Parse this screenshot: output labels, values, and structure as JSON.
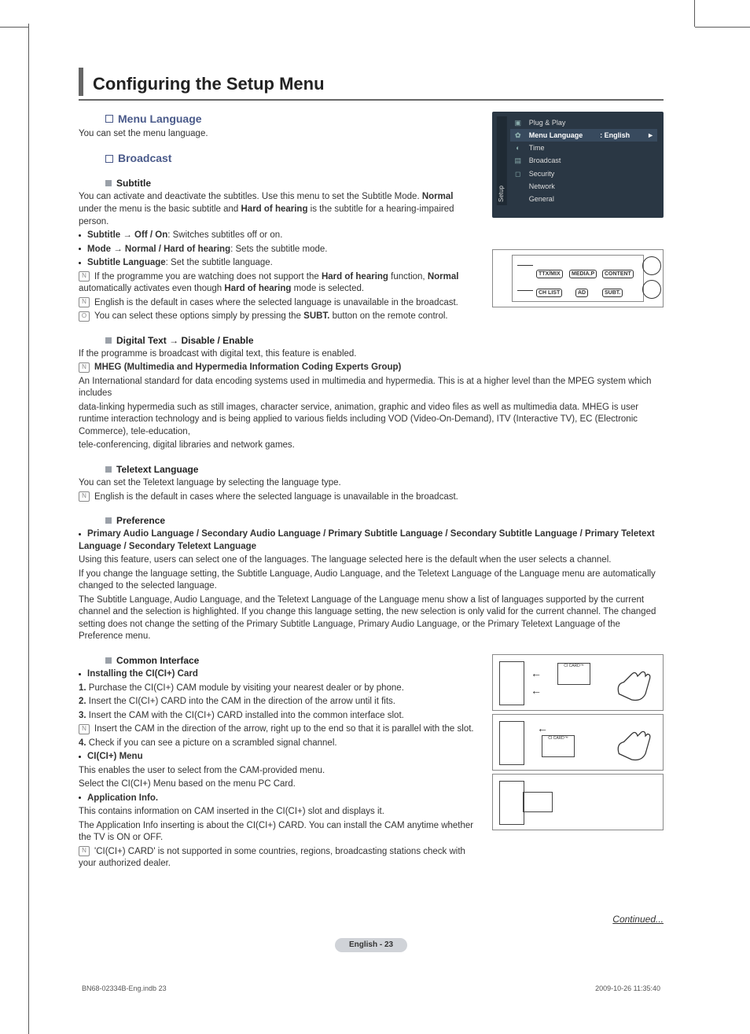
{
  "title": "Configuring the Setup Menu",
  "menuLanguage": {
    "heading": "Menu Language",
    "desc": "You can set the menu language."
  },
  "broadcast": {
    "heading": "Broadcast"
  },
  "subtitle": {
    "heading": "Subtitle",
    "p1a": "You can activate and deactivate the subtitles. Use this menu to set the Subtitle Mode. ",
    "p1b_bold": "Normal",
    "p1c": " under the menu is the basic subtitle and ",
    "p1d_bold": "Hard of hearing",
    "p1e": " is the subtitle for a hearing-impaired person.",
    "b1_bold": "Subtitle → Off / On",
    "b1_rest": ": Switches subtitles off or on.",
    "b2_bold": "Mode → Normal / Hard of hearing",
    "b2_rest": ": Sets the subtitle mode.",
    "b3_bold": "Subtitle Language",
    "b3_rest": ": Set the subtitle language.",
    "n1a": "If the programme you are watching does not support the ",
    "n1b_bold": "Hard of hearing",
    "n1c": " function, ",
    "n1d_bold": "Normal",
    "n1e": " automatically activates even though ",
    "n1f_bold": "Hard of hearing",
    "n1g": " mode is selected.",
    "n2": "English is the default in cases where the selected language is unavailable in the broadcast.",
    "n3a": "You can select these options simply by pressing the ",
    "n3b_bold": "SUBT.",
    "n3c": " button on the remote control."
  },
  "osd": {
    "sideLabel": "Setup",
    "items": [
      "Plug & Play",
      "Menu Language",
      "Time",
      "Broadcast",
      "Security",
      "Network",
      "General"
    ],
    "selectedValue": ": English",
    "arrow": "►"
  },
  "remote": {
    "btns": [
      "TTX/MIX",
      "MEDIA.P",
      "CONTENT",
      "CH LIST",
      "AD",
      "SUBT."
    ]
  },
  "digitalText": {
    "heading": "Digital Text → Disable / Enable",
    "desc": "If the programme is broadcast with digital text, this feature is enabled.",
    "mheg_bold": "MHEG (Multimedia and Hypermedia Information Coding Experts Group)",
    "mheg_p1": "An International standard for data encoding systems used in multimedia and hypermedia. This is at a higher level than the MPEG system which includes",
    "mheg_p2": "data-linking hypermedia such as still images, character service, animation, graphic and video files as well as multimedia data. MHEG is user runtime interaction technology and is being applied to various fields including VOD (Video-On-Demand), ITV (Interactive TV), EC (Electronic Commerce), tele-education,",
    "mheg_p3": "tele-conferencing, digital libraries and network games."
  },
  "teletext": {
    "heading": "Teletext Language",
    "desc": "You can set the Teletext language by selecting the language type.",
    "note": "English is the default in cases where the selected language is unavailable in the broadcast."
  },
  "preference": {
    "heading": "Preference",
    "bold": "Primary Audio Language / Secondary Audio Language / Primary Subtitle Language / Secondary Subtitle Language / Primary Teletext Language / Secondary Teletext Language",
    "p1": "Using this feature, users can select one of the languages. The language selected here is the default when the user selects a channel.",
    "p2": "If you change the language setting, the Subtitle Language, Audio Language, and the Teletext Language of the Language menu are automatically changed to the selected language.",
    "p3": "The Subtitle Language, Audio Language, and the Teletext Language of the Language menu show a list of languages supported by the current channel and the selection is highlighted. If you change this language setting, the new selection is only valid for the current channel. The changed setting does not change the setting of the Primary Subtitle Language, Primary Audio Language, or the Primary Teletext Language of the Preference menu."
  },
  "ci": {
    "heading": "Common Interface",
    "install_h": "Installing the CI(CI+) Card",
    "s1_bold": "1.",
    "s1": " Purchase the CI(CI+) CAM module by visiting your nearest dealer or by phone.",
    "s2_bold": "2.",
    "s2": " Insert the CI(CI+) CARD into the CAM in the direction of the arrow until it fits.",
    "s3_bold": "3.",
    "s3": " Insert the CAM with the CI(CI+) CARD installed into the common interface slot.",
    "s3_note": "Insert the CAM in the direction of the arrow, right up to the end so that it is parallel with the slot.",
    "s4_bold": "4.",
    "s4": " Check if you can see a picture on a scrambled signal channel.",
    "menu_h": "CI(CI+) Menu",
    "menu_p1": "This enables the user to select from the CAM-provided menu.",
    "menu_p2": "Select the CI(CI+) Menu based on the menu PC Card.",
    "app_h": "Application Info.",
    "app_p1": "This contains information on CAM inserted in the CI(CI+) slot and displays it.",
    "app_p2": "The Application Info inserting is about the CI(CI+) CARD. You can install the CAM anytime whether the TV is ON or OFF.",
    "app_note": "'CI(CI+) CARD' is not supported in some countries, regions, broadcasting stations check with your authorized dealer."
  },
  "ci_illus": {
    "cardLabel": "CI CARD™"
  },
  "continued": "Continued...",
  "pageLabel": "English - 23",
  "footer": {
    "left": "BN68-02334B-Eng.indb   23",
    "rightDate": "2009-10-26   ",
    "rightTime": " 11:35:40"
  }
}
